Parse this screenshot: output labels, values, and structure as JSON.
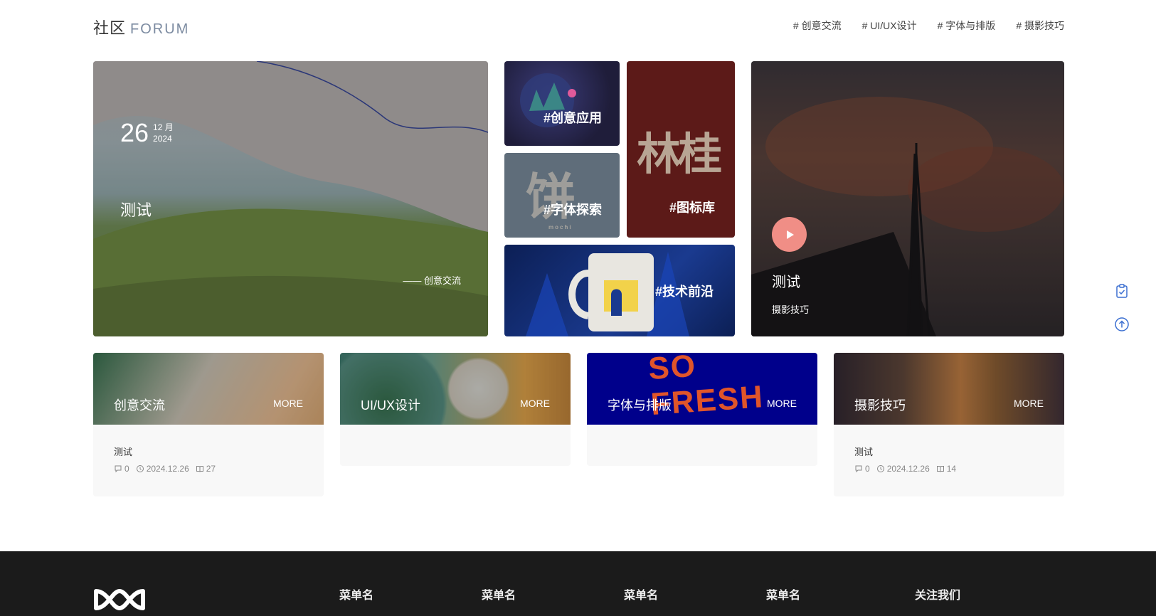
{
  "header": {
    "logo_cn": "社区",
    "logo_en": "FORUM",
    "nav": [
      "# 创意交流",
      "# UI/UX设计",
      "# 字体与排版",
      "# 摄影技巧"
    ]
  },
  "hero": {
    "day": "26",
    "month": "12 月",
    "year": "2024",
    "title": "测试",
    "category": "—— 创意交流"
  },
  "tiles": {
    "t1": "#创意应用",
    "t2": "#字体探索",
    "t2_deco": "mochi",
    "t3": "#图标库",
    "t4": "#技术前沿"
  },
  "hero_right": {
    "title": "测试",
    "category": "摄影技巧"
  },
  "categories": [
    {
      "name": "创意交流",
      "more": "MORE",
      "color": "#3b7a57",
      "posts": [
        {
          "title": "测试",
          "comments": "0",
          "date": "2024.12.26",
          "views": "27"
        }
      ]
    },
    {
      "name": "UI/UX设计",
      "more": "MORE",
      "color": "#4f8a7a",
      "posts": []
    },
    {
      "name": "字体与排版",
      "more": "MORE",
      "color": "#00008b",
      "posts": []
    },
    {
      "name": "摄影技巧",
      "more": "MORE",
      "color": "#7a4a2a",
      "posts": [
        {
          "title": "测试",
          "comments": "0",
          "date": "2024.12.26",
          "views": "14"
        }
      ]
    }
  ],
  "footer": {
    "columns": [
      "菜单名",
      "菜单名",
      "菜单名",
      "菜单名",
      "关注我们"
    ]
  },
  "colors": {
    "accent": "#f08e86",
    "footer_bg": "#1b1b1b",
    "tool_icon": "#3b6fd1"
  },
  "icons": {
    "play": "play-icon",
    "clipboard": "clipboard-check-icon",
    "back_top": "arrow-up-circle-icon",
    "comment": "comment-icon",
    "clock": "clock-icon",
    "book": "book-icon"
  }
}
